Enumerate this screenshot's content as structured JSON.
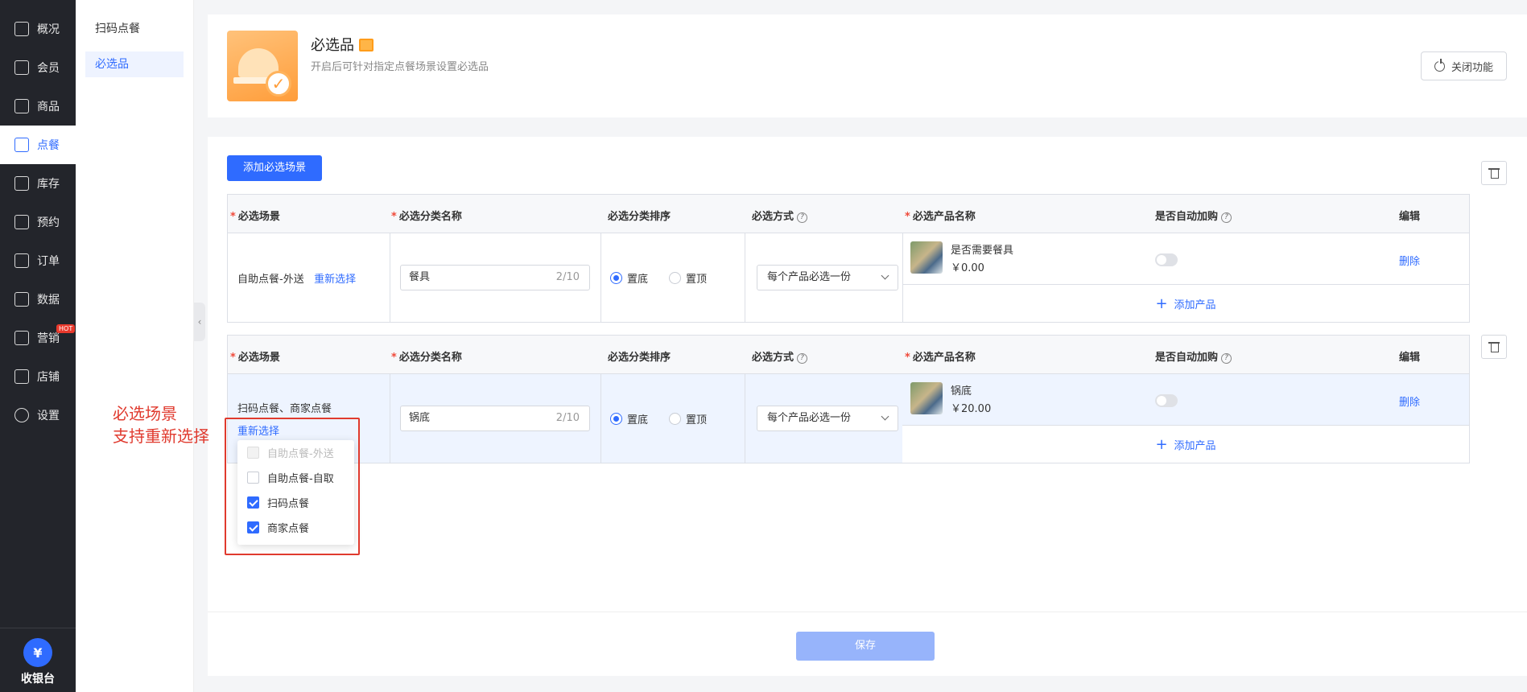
{
  "nav": {
    "items": [
      {
        "label": "概况"
      },
      {
        "label": "会员"
      },
      {
        "label": "商品"
      },
      {
        "label": "点餐"
      },
      {
        "label": "库存"
      },
      {
        "label": "预约"
      },
      {
        "label": "订单"
      },
      {
        "label": "数据"
      },
      {
        "label": "营销"
      },
      {
        "label": "店铺"
      },
      {
        "label": "设置"
      }
    ],
    "hot_badge": "HOT",
    "cashier_label": "收银台",
    "cashier_icon": "¥"
  },
  "subnav": {
    "items": [
      {
        "label": "扫码点餐"
      },
      {
        "label": "必选品"
      }
    ]
  },
  "feature": {
    "title": "必选品",
    "desc": "开启后可针对指定点餐场景设置必选品",
    "close_label": "关闭功能"
  },
  "main": {
    "add_scene_label": "添加必选场景",
    "headers": {
      "scene": "必选场景",
      "category": "必选分类名称",
      "order": "必选分类排序",
      "mode": "必选方式",
      "product": "必选产品名称",
      "auto_add": "是否自动加购",
      "edit": "编辑"
    },
    "required_mark": "*",
    "help_mark": "?",
    "rows": [
      {
        "scene": "自助点餐-外送",
        "reselect": "重新选择",
        "category_value": "餐具",
        "category_count": "2/10",
        "order_bottom": "置底",
        "order_top": "置顶",
        "mode": "每个产品必选一份",
        "product_name": "是否需要餐具",
        "product_price": "￥0.00",
        "delete": "删除",
        "add_product": "添加产品"
      },
      {
        "scene": "扫码点餐、商家点餐",
        "reselect": "重新选择",
        "category_value": "锅底",
        "category_count": "2/10",
        "order_bottom": "置底",
        "order_top": "置顶",
        "mode": "每个产品必选一份",
        "product_name": "锅底",
        "product_price": "￥20.00",
        "delete": "删除",
        "add_product": "添加产品"
      }
    ],
    "dropdown": [
      {
        "label": "自助点餐-外送",
        "checked": false,
        "disabled": true
      },
      {
        "label": "自助点餐-自取",
        "checked": false,
        "disabled": false
      },
      {
        "label": "扫码点餐",
        "checked": true,
        "disabled": false
      },
      {
        "label": "商家点餐",
        "checked": true,
        "disabled": false
      }
    ],
    "save_label": "保存"
  },
  "annotation": {
    "line1": "必选场景",
    "line2": "支持重新选择"
  },
  "colors": {
    "accent": "#2f6bff",
    "annotation": "#e03a2e",
    "nav_bg": "#23252b"
  }
}
